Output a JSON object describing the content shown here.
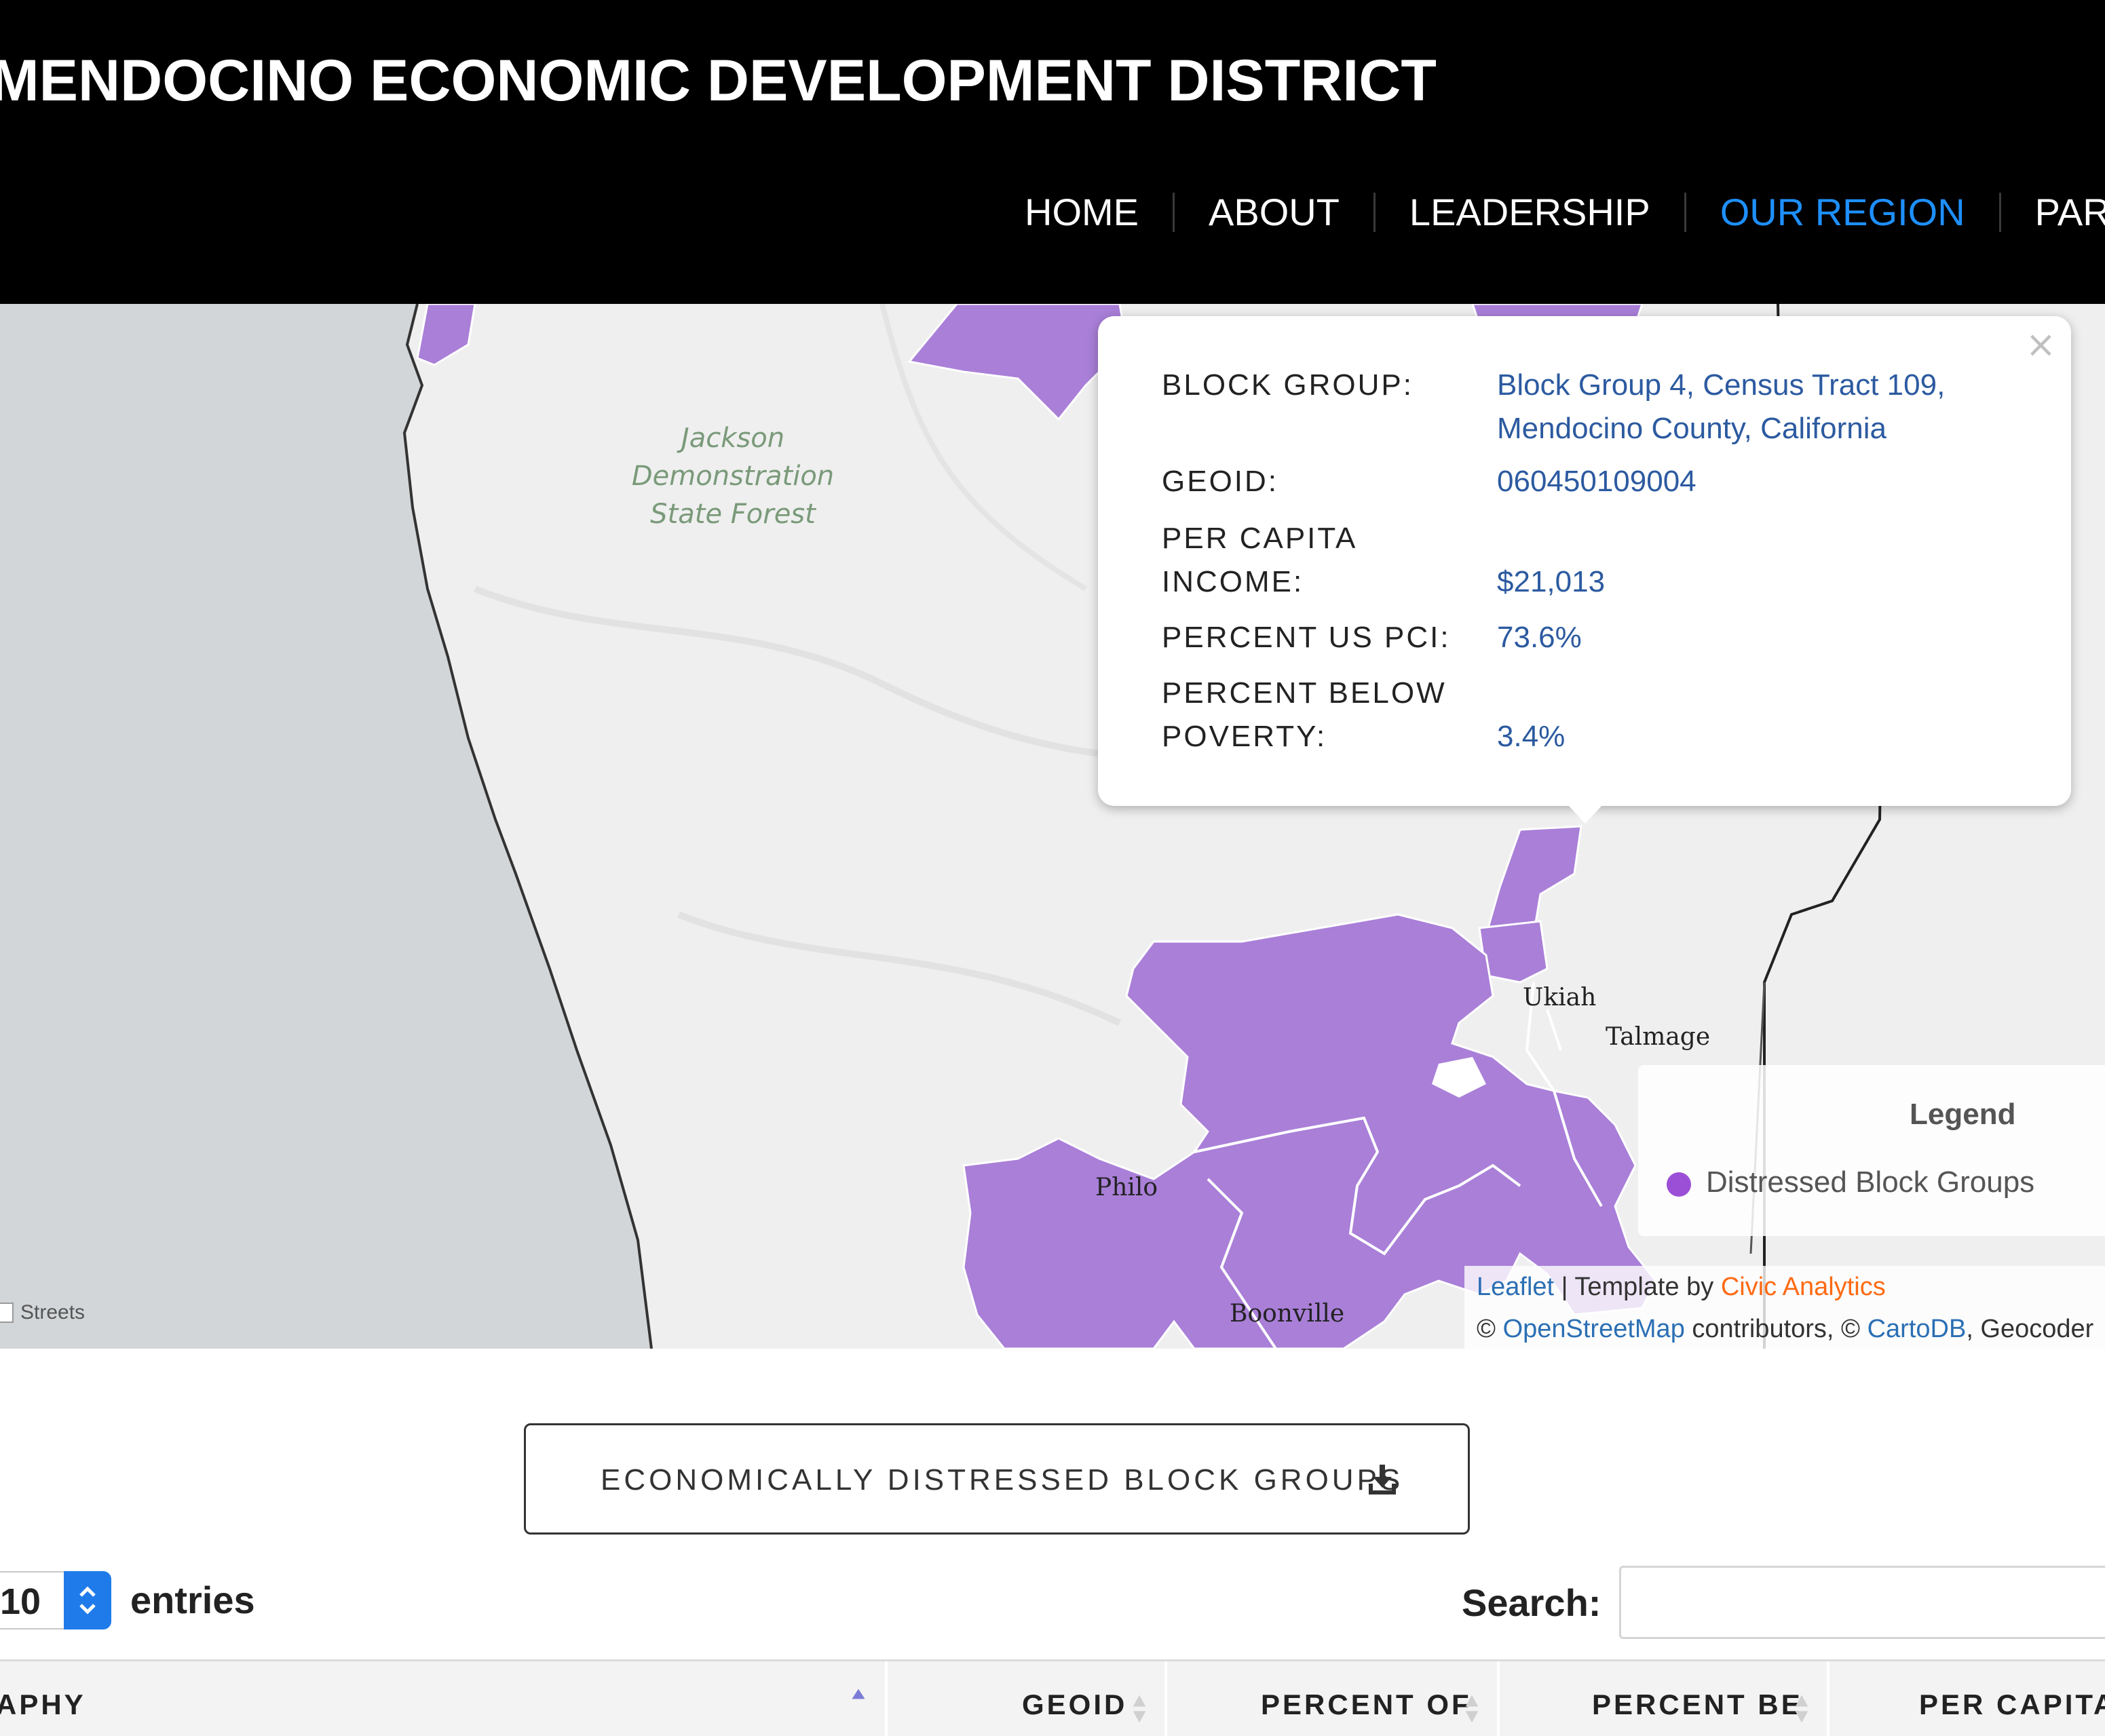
{
  "header": {
    "title": "MENDOCINO ECONOMIC DEVELOPMENT DISTRICT",
    "nav": [
      "HOME",
      "ABOUT",
      "LEADERSHIP",
      "OUR REGION",
      "PART"
    ],
    "active_nav": "OUR REGION",
    "active_color": "#1e90ff"
  },
  "map": {
    "forest_label": [
      "Jackson",
      "Demonstration",
      "State Forest"
    ],
    "places": {
      "ukiah": "Ukiah",
      "talmage": "Talmage",
      "philo": "Philo",
      "boonville": "Boonville"
    },
    "layer_control": "Streets",
    "fill_color": "#a97fd8",
    "popup": {
      "close": "×",
      "rows": [
        {
          "label": "BLOCK GROUP:",
          "value": "Block Group 4, Census Tract 109, Mendocino County, California"
        },
        {
          "label": "GEOID:",
          "value": "060450109004"
        },
        {
          "label": "PER CAPITA INCOME:",
          "value": "$21,013"
        },
        {
          "label": "PERCENT US PCI:",
          "value": "73.6%"
        },
        {
          "label": "PERCENT BELOW POVERTY:",
          "value": "3.4%"
        }
      ]
    },
    "legend": {
      "title": "Legend",
      "item": "Distressed Block Groups",
      "color": "#9b4fd6"
    },
    "attribution": {
      "leaflet": "Leaflet",
      "sep": " | Template by ",
      "civic": "Civic Analytics",
      "copy1": "© ",
      "osm": "OpenStreetMap",
      "contrib": " contributors, © ",
      "cartodb": "CartoDB",
      "geoco": ", Geocoder"
    }
  },
  "download_button": {
    "label": "ECONOMICALLY DISTRESSED BLOCK GROUPS",
    "icon": "download-icon"
  },
  "table": {
    "entries_value": "10",
    "entries_label": "entries",
    "search_label": "Search:",
    "columns": [
      "APHY",
      "GEOID",
      "PERCENT OF",
      "PERCENT BE",
      "PER CAPITA"
    ]
  }
}
